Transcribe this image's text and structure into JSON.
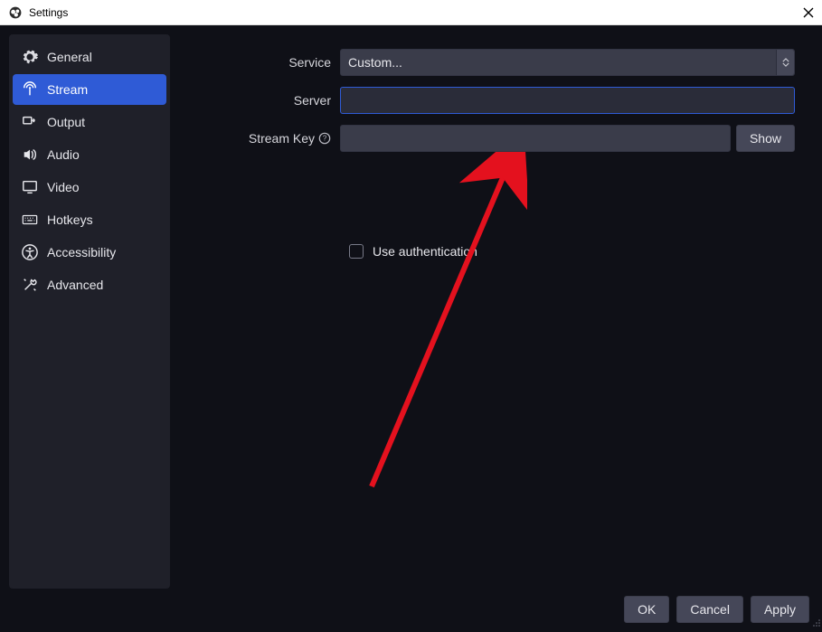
{
  "window": {
    "title": "Settings"
  },
  "sidebar": {
    "items": [
      {
        "label": "General",
        "icon": "gear-icon"
      },
      {
        "label": "Stream",
        "icon": "antenna-icon"
      },
      {
        "label": "Output",
        "icon": "output-icon"
      },
      {
        "label": "Audio",
        "icon": "speaker-icon"
      },
      {
        "label": "Video",
        "icon": "monitor-icon"
      },
      {
        "label": "Hotkeys",
        "icon": "keyboard-icon"
      },
      {
        "label": "Accessibility",
        "icon": "accessibility-icon"
      },
      {
        "label": "Advanced",
        "icon": "tools-icon"
      }
    ],
    "active_index": 1
  },
  "stream": {
    "service_label": "Service",
    "service_value": "Custom...",
    "server_label": "Server",
    "server_value": "",
    "key_label": "Stream Key",
    "key_value": "",
    "show_button": "Show",
    "use_auth_label": "Use authentication",
    "use_auth_checked": false
  },
  "footer": {
    "ok": "OK",
    "cancel": "Cancel",
    "apply": "Apply"
  }
}
